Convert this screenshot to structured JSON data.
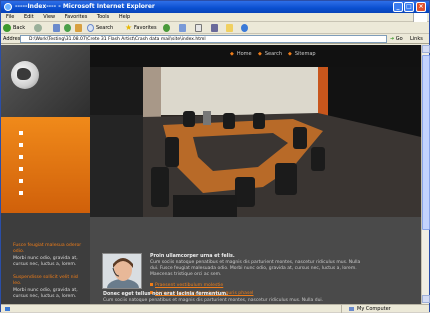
{
  "window": {
    "title": "-----Index---- - Microsoft Internet Explorer"
  },
  "menu": [
    "File",
    "Edit",
    "View",
    "Favorites",
    "Tools",
    "Help"
  ],
  "toolbar": {
    "back": "Back",
    "search": "Search",
    "favorites": "Favorites"
  },
  "address": {
    "label": "Address",
    "value": "D:\\Work\\Testing\\31.08.07\\Crete 31 Flash Artist\\Crash data mail\\site\\index.html",
    "go": "Go",
    "links": "Links"
  },
  "site": {
    "nav": [
      {
        "label": "Home"
      },
      {
        "label": "Search"
      },
      {
        "label": "Sitemap"
      }
    ],
    "sidebar_blocks": [
      {
        "head": "Fusce feugiat malesua oderor odio.",
        "body": "Morbi nunc odio, gravida at, cursus nec, luctus a, lorem."
      },
      {
        "head": "Suspendisse sollicit velit nisl leo.",
        "body": "Morbi nunc odio, gravida at, cursus nec, luctus a, lorem."
      }
    ],
    "intro_head": "Proin ullamcorper urna et felis.",
    "intro_body": "Cum sociis natoque penatibus et magnis dis parturient montes, nascetur ridiculus mus. Nulla dui. Fusce feugiat malesuada odio. Morbi nunc odio, gravida at, cursus nec, luctus a, lorem. Maecenas tristique orci ac sem.",
    "links": [
      "Praesent vestibulum molestie",
      "Aenean nonummy hendrerit mauris phasel"
    ],
    "second_head": "Donec eget tellus non erat lacinia fermentum.",
    "second_body": "Cum sociis natoque penatibus et magnis dis parturient montes, nascetur ridiculus mus. Nulla dui."
  },
  "status": {
    "zone": "My Computer"
  },
  "colors": {
    "accent": "#f07d18",
    "titlebar": "#0a4fd0",
    "page_bg": "#333333"
  }
}
